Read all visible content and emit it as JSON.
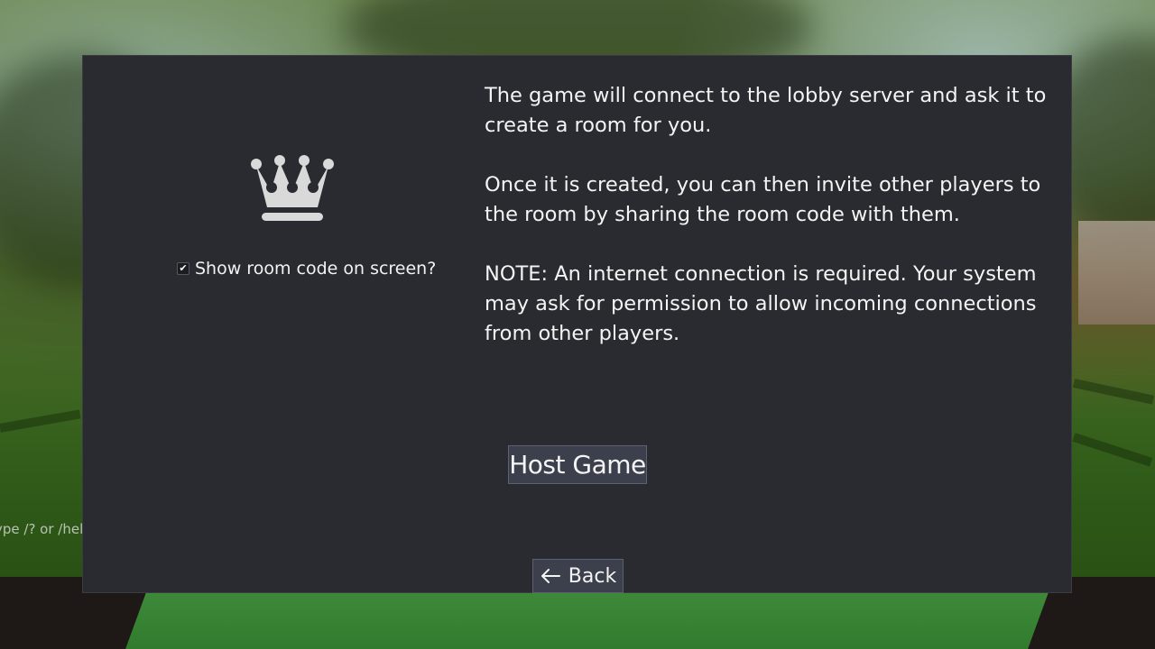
{
  "background": {
    "chat_hint": "ype /? or /help"
  },
  "dialog": {
    "icon": "crown-icon",
    "show_room_code": {
      "label": "Show room code on screen?",
      "checked": true,
      "check_glyph": "✔"
    },
    "paragraphs": [
      "The game will connect to the lobby server and ask it to create a room for you.",
      "Once it is created, you can then invite other players to the room by sharing the room code with them.",
      "NOTE: An internet connection is required. Your system may ask for permission to allow incoming connections from other players."
    ],
    "host_button": "Host Game",
    "back_button": "Back",
    "back_icon": "arrow-left-icon"
  },
  "colors": {
    "panel": "#2a2a31",
    "button": "#3c3f4c",
    "text": "#f4f4f4",
    "icon": "#d9d9d9"
  }
}
